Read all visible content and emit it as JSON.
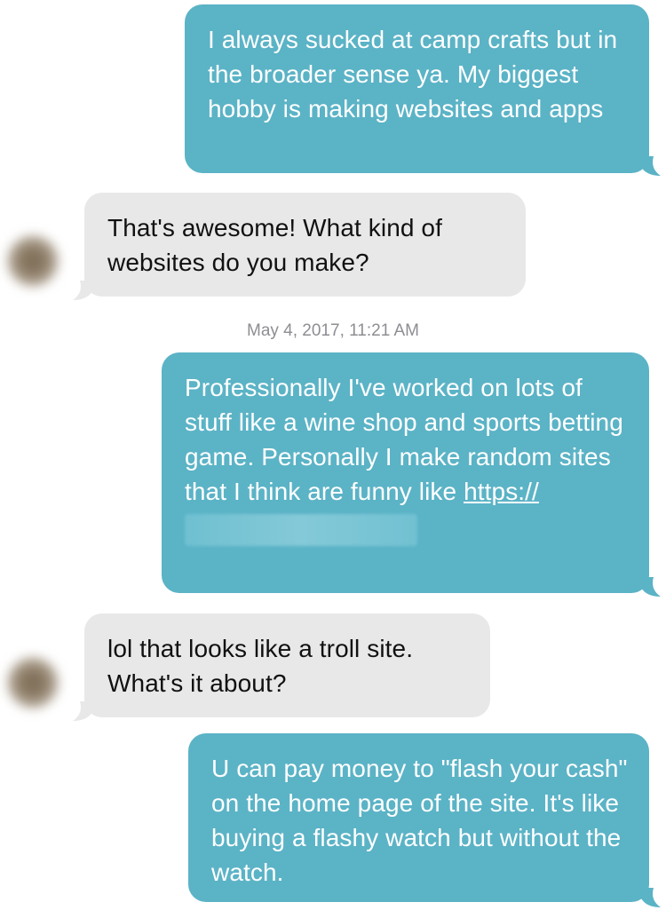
{
  "conversation": {
    "messages": [
      {
        "direction": "outgoing",
        "text": "I always sucked at camp crafts but in the broader sense ya. My biggest hobby is making websites and apps"
      },
      {
        "direction": "incoming",
        "text": "That's awesome! What kind of websites do you make?"
      },
      {
        "direction": "outgoing",
        "text": "Professionally I've worked on lots of stuff like a wine shop and sports betting game. Personally I make random sites that I think are funny like ",
        "link_text": "https://"
      },
      {
        "direction": "incoming",
        "text": "lol that looks like a troll site. What's it about?"
      },
      {
        "direction": "outgoing",
        "text": "U can pay money to \"flash your cash\" on the home page of the site. It's like buying a flashy watch but without the watch."
      }
    ],
    "timestamp": "May 4, 2017, 11:21 AM"
  },
  "colors": {
    "outgoing_bubble": "#5bb3c6",
    "incoming_bubble": "#e8e8e8",
    "timestamp_text": "#8e8e93"
  }
}
